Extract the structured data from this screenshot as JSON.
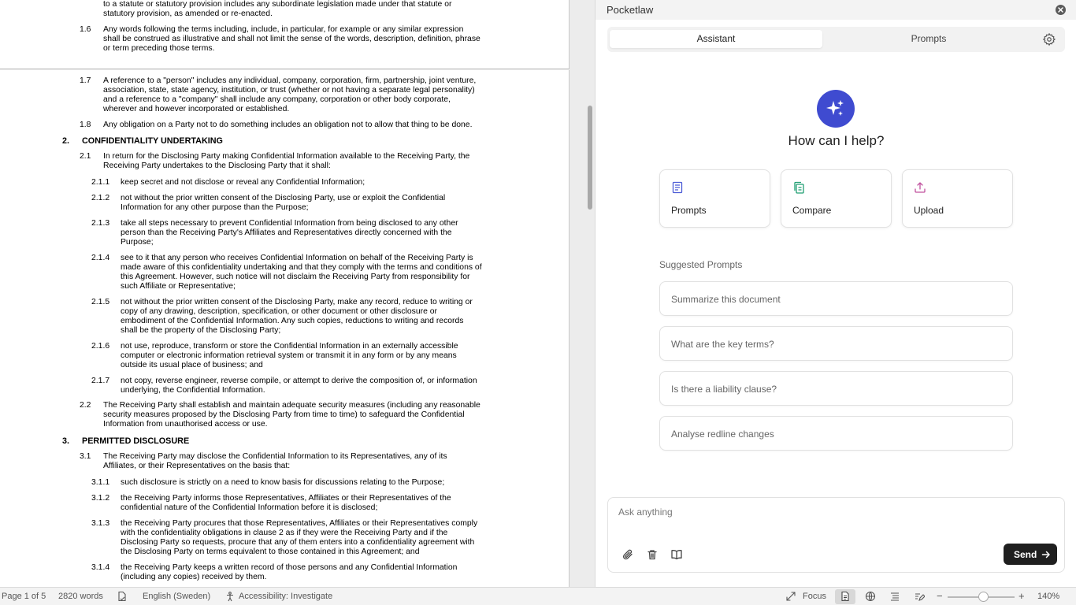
{
  "document": {
    "page1_lines": [
      {
        "text": "to a statute or statutory provision includes any subordinate legislation made under that statute or\nstatutory provision, as amended or re-enacted."
      },
      {
        "num": "1.6",
        "text": "Any words following the terms including, include, in particular, for example or any similar expression\nshall be construed as illustrative and shall not limit the sense of the words, description, definition, phrase\nor term preceding those terms."
      }
    ],
    "clauses": [
      {
        "num": "1.7",
        "text": "A reference to a \"person\" includes any individual, company, corporation, firm, partnership, joint venture,\nassociation, state, state agency, institution, or trust (whether or not having a separate legal personality)\nand a reference to a \"company\" shall include any company, corporation or other body corporate,\nwherever and however incorporated or established."
      },
      {
        "num": "1.8",
        "text": "Any obligation on a Party not to do something includes an obligation not to allow that thing to be done."
      },
      {
        "num": "2.",
        "text": "CONFIDENTIALITY UNDERTAKING"
      },
      {
        "num": "2.1",
        "text": "In return for the Disclosing Party making Confidential Information available to the Receiving Party, the\nReceiving Party undertakes to the Disclosing Party that it shall:"
      },
      {
        "num": "2.1.1",
        "text": "keep secret and not disclose or reveal any Confidential Information;"
      },
      {
        "num": "2.1.2",
        "text": "not without the prior written consent of the Disclosing Party, use or exploit the Confidential\nInformation for any other purpose than the Purpose;"
      },
      {
        "num": "2.1.3",
        "text": "take all steps necessary to prevent Confidential Information from being disclosed to any other\nperson than the Receiving Party's Affiliates and Representatives directly concerned with the\nPurpose;"
      },
      {
        "num": "2.1.4",
        "text": "see to it that any person who receives Confidential Information on behalf of the Receiving Party is\nmade aware of this confidentiality undertaking and that they comply with the terms and conditions of\nthis Agreement. However, such notice will not disclaim the Receiving Party from responsibility for\nsuch Affiliate or Representative;"
      },
      {
        "num": "2.1.5",
        "text": "not without the prior written consent of the Disclosing Party, make any record, reduce to writing or\ncopy of any drawing, description, specification, or other document or other disclosure or\nembodiment of the Confidential Information. Any such copies, reductions to writing and records\nshall be the property of the Disclosing Party;"
      },
      {
        "num": "2.1.6",
        "text": "not use, reproduce, transform or store the Confidential Information in an externally accessible\ncomputer or electronic information retrieval system or transmit it in any form or by any means\noutside its usual place of business; and"
      },
      {
        "num": "2.1.7",
        "text": "not copy, reverse engineer, reverse compile, or attempt to derive the composition of, or information\nunderlying, the Confidential Information."
      },
      {
        "num": "2.2",
        "text": "The Receiving Party shall establish and maintain adequate security measures (including any reasonable\nsecurity measures proposed by the Disclosing Party from time to time) to safeguard the Confidential\nInformation from unauthorised access or use."
      },
      {
        "num": "3.",
        "text": "PERMITTED DISCLOSURE"
      },
      {
        "num": "3.1",
        "text": "The Receiving Party may disclose the Confidential Information to its Representatives, any of its\nAffiliates, or their Representatives on the basis that:"
      },
      {
        "num": "3.1.1",
        "text": "such disclosure is strictly on a need to know basis for discussions relating to the Purpose;"
      },
      {
        "num": "3.1.2",
        "text": "the Receiving Party informs those Representatives, Affiliates or their Representatives of the\nconfidential nature of the Confidential Information before it is disclosed;"
      },
      {
        "num": "3.1.3",
        "text": "the Receiving Party procures that those Representatives, Affiliates or their Representatives comply\nwith the confidentiality obligations in clause 2 as if they were the Receiving Party and if the\nDisclosing Party so requests, procure that any of them enters into a confidentiality agreement with\nthe Disclosing Party on terms equivalent to those contained in this Agreement; and"
      },
      {
        "num": "3.1.4",
        "text": "the Receiving Party keeps a written record of those persons and any Confidential Information\n(including any copies) received by them."
      }
    ]
  },
  "status_bar": {
    "page": "Page 1 of 5",
    "words": "2820 words",
    "language": "English (Sweden)",
    "accessibility": "Accessibility: Investigate",
    "focus": "Focus",
    "zoom": "140%",
    "zoom_level_percent": 140
  },
  "panel": {
    "title": "Pocketlaw",
    "tabs": [
      {
        "label": "Assistant",
        "active": true
      },
      {
        "label": "Prompts",
        "active": false
      }
    ],
    "hero_title": "How can I help?",
    "actions": [
      {
        "label": "Prompts",
        "icon": "book-icon",
        "color": "#4b5bd6"
      },
      {
        "label": "Compare",
        "icon": "copy-icon",
        "color": "#1f9e72"
      },
      {
        "label": "Upload",
        "icon": "upload-icon",
        "color": "#c0509e"
      }
    ],
    "suggested_title": "Suggested Prompts",
    "suggested": [
      "Summarize this document",
      "What are the key terms?",
      "Is there a liability clause?",
      "Analyse redline changes"
    ],
    "composer": {
      "placeholder": "Ask anything",
      "send_label": "Send"
    },
    "accent_color": "#3f4bd0"
  }
}
